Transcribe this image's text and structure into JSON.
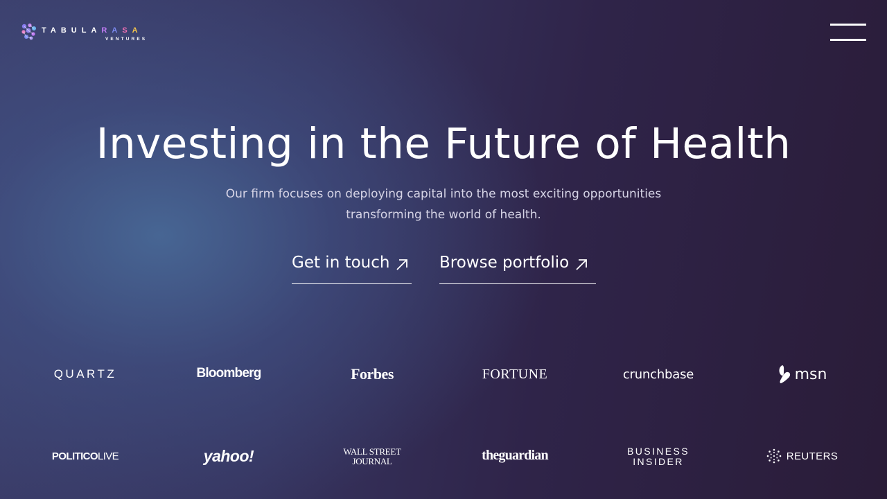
{
  "header": {
    "logo": {
      "wordmark_part1": "TABULA",
      "wordmark_r": "R",
      "wordmark_a1": "A",
      "wordmark_s": "S",
      "wordmark_a2": "A",
      "subtext": "VENTURES"
    },
    "menu_icon": "hamburger-menu-icon"
  },
  "hero": {
    "title": "Investing in the Future of Health",
    "subtitle_line1": "Our firm focuses on deploying capital into the most exciting opportunities",
    "subtitle_line2": "transforming the world of health.",
    "cta_primary": "Get in touch",
    "cta_secondary": "Browse portfolio",
    "cta_icon": "arrow-up-right-icon"
  },
  "press": {
    "row1": [
      "QUARTZ",
      "Bloomberg",
      "Forbes",
      "FORTUNE",
      "crunchbase",
      "msn"
    ],
    "row2_politico_a": "POLITICO",
    "row2_politico_b": "LIVE",
    "row2_yahoo": "yahoo!",
    "row2_wsj_line1": "WALL STREET",
    "row2_wsj_line2": "JOURNAL",
    "row2_guardian": "theguardian",
    "row2_bi_line1": "BUSINESS",
    "row2_bi_line2": "INSIDER",
    "row2_reuters": "REUTERS"
  },
  "colors": {
    "background_dark": "#2a1c38",
    "background_glow": "#486896",
    "text_primary": "#ffffff",
    "text_secondary": "#d6d4e6",
    "logo_r": "#c17cf5",
    "logo_a": "#7d8bf2",
    "logo_s": "#ec6fb3",
    "logo_a2": "#f5c64b"
  }
}
